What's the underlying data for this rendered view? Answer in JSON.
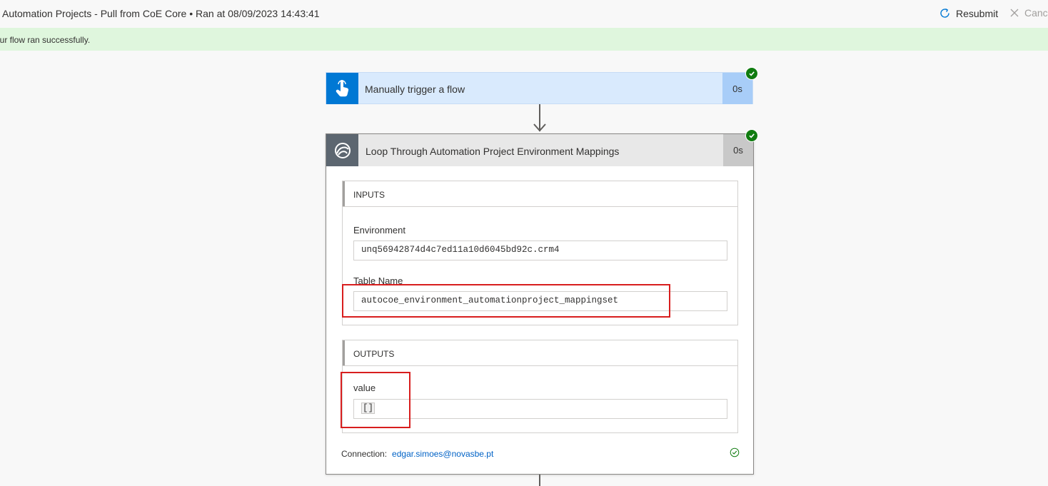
{
  "header": {
    "run_title": "Automation Projects - Pull from CoE Core • Ran at 08/09/2023 14:43:41",
    "resubmit_label": "Resubmit",
    "cancel_label": "Canc"
  },
  "banner": {
    "message": "our flow ran successfully."
  },
  "trigger": {
    "title": "Manually trigger a flow",
    "duration": "0s",
    "icon": "hand-pointer-icon",
    "status": "succeeded"
  },
  "loop": {
    "title": "Loop Through Automation Project Environment Mappings",
    "duration": "0s",
    "icon": "dataverse-icon",
    "status": "succeeded",
    "inputs": {
      "header": "INPUTS",
      "environment_label": "Environment",
      "environment_value": "unq56942874d4c7ed11a10d6045bd92c.crm4",
      "table_label": "Table Name",
      "table_value": "autocoe_environment_automationproject_mappingset"
    },
    "outputs": {
      "header": "OUTPUTS",
      "value_label": "value",
      "value_value": "[]"
    },
    "connection": {
      "label": "Connection:",
      "account": "edgar.simoes@novasbe.pt"
    }
  },
  "colors": {
    "success_banner": "#dff6dd",
    "trigger_accent": "#0078d4",
    "status_success": "#107c10",
    "highlight": "#d81e1e",
    "link": "#0062c6"
  }
}
